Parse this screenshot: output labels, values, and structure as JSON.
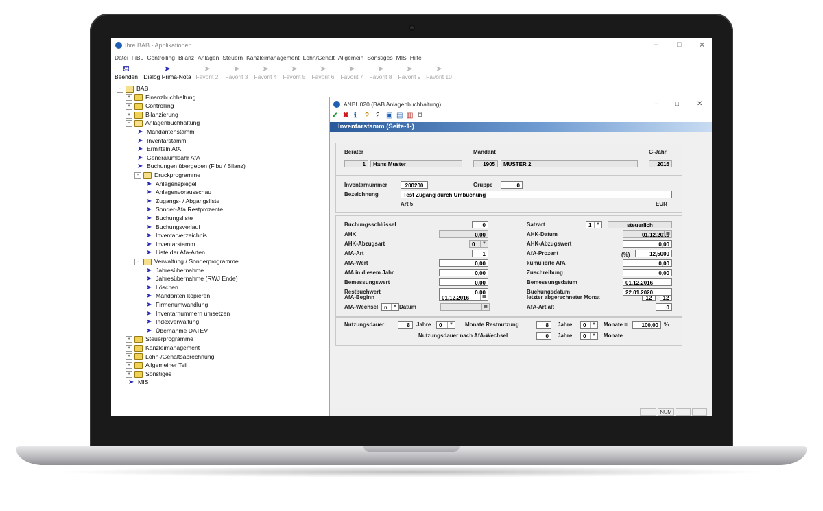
{
  "window": {
    "title": "Ihre BAB - Applikationen",
    "controls": [
      "–",
      "□",
      "✕"
    ]
  },
  "menu": [
    "Datei",
    "FiBu",
    "Controlling",
    "Bilanz",
    "Anlagen",
    "Steuern",
    "Kanzleimanagement",
    "Lohn/Gehalt",
    "Allgemein",
    "Sonstiges",
    "MIS",
    "Hilfe"
  ],
  "toolbar": [
    {
      "label": "Beenden",
      "icon": "exit-icon",
      "enabled": true
    },
    {
      "label": "Dialog Prima-Nota",
      "icon": "arrow-icon",
      "enabled": true
    },
    {
      "label": "Favorit 2",
      "icon": "arrow-icon",
      "enabled": false
    },
    {
      "label": "Favorit 3",
      "icon": "arrow-icon",
      "enabled": false
    },
    {
      "label": "Favorit 4",
      "icon": "arrow-icon",
      "enabled": false
    },
    {
      "label": "Favorit 5",
      "icon": "arrow-icon",
      "enabled": false
    },
    {
      "label": "Favorit 6",
      "icon": "arrow-icon",
      "enabled": false
    },
    {
      "label": "Favorit 7",
      "icon": "arrow-icon",
      "enabled": false
    },
    {
      "label": "Favorit 8",
      "icon": "arrow-icon",
      "enabled": false
    },
    {
      "label": "Favorit 9",
      "icon": "arrow-icon",
      "enabled": false
    },
    {
      "label": "Favorit 10",
      "icon": "arrow-icon",
      "enabled": false
    }
  ],
  "tree": [
    {
      "label": "BAB",
      "level": 0,
      "type": "folder-open",
      "exp": "-"
    },
    {
      "label": "Finanzbuchhaltung",
      "level": 1,
      "type": "folder",
      "exp": "+"
    },
    {
      "label": "Controlling",
      "level": 1,
      "type": "folder",
      "exp": "+"
    },
    {
      "label": "Bilanzierung",
      "level": 1,
      "type": "folder",
      "exp": "+"
    },
    {
      "label": "Anlagenbuchhaltung",
      "level": 1,
      "type": "folder-open",
      "exp": "-"
    },
    {
      "label": "Mandantenstamm",
      "level": 2,
      "type": "arrow"
    },
    {
      "label": "Inventarstamm",
      "level": 2,
      "type": "arrow"
    },
    {
      "label": "Ermitteln AfA",
      "level": 2,
      "type": "arrow"
    },
    {
      "label": "Generalumlsahr AfA",
      "level": 2,
      "type": "arrow"
    },
    {
      "label": "Buchungen übergeben (Fibu / Bilanz)",
      "level": 2,
      "type": "arrow"
    },
    {
      "label": "Druckprogramme",
      "level": 2,
      "type": "folder-open",
      "exp": "-"
    },
    {
      "label": "Anlagenspiegel",
      "level": 3,
      "type": "arrow"
    },
    {
      "label": "Anlagenvorausschau",
      "level": 3,
      "type": "arrow"
    },
    {
      "label": "Zugangs- / Abgangsliste",
      "level": 3,
      "type": "arrow"
    },
    {
      "label": "Sonder-Afa Restprozente",
      "level": 3,
      "type": "arrow"
    },
    {
      "label": "Buchungsliste",
      "level": 3,
      "type": "arrow"
    },
    {
      "label": "Buchungsverlauf",
      "level": 3,
      "type": "arrow"
    },
    {
      "label": "Inventarverzeichnis",
      "level": 3,
      "type": "arrow"
    },
    {
      "label": "Inventarstamm",
      "level": 3,
      "type": "arrow"
    },
    {
      "label": "Liste der Afa-Arten",
      "level": 3,
      "type": "arrow"
    },
    {
      "label": "Verwaltung / Sonderprogramme",
      "level": 2,
      "type": "folder-open",
      "exp": "-"
    },
    {
      "label": "Jahresübernahme",
      "level": 3,
      "type": "arrow"
    },
    {
      "label": "Jahresübernahme (RWJ Ende)",
      "level": 3,
      "type": "arrow"
    },
    {
      "label": "Löschen",
      "level": 3,
      "type": "arrow"
    },
    {
      "label": "Mandanten kopieren",
      "level": 3,
      "type": "arrow"
    },
    {
      "label": "Firmenumwandlung",
      "level": 3,
      "type": "arrow"
    },
    {
      "label": "Inventarnummern umsetzen",
      "level": 3,
      "type": "arrow"
    },
    {
      "label": "Indexverwaltung",
      "level": 3,
      "type": "arrow"
    },
    {
      "label": "Übernahme DATEV",
      "level": 3,
      "type": "arrow"
    },
    {
      "label": "Steuerprogramme",
      "level": 1,
      "type": "folder",
      "exp": "+"
    },
    {
      "label": "Kanzleimanagement",
      "level": 1,
      "type": "folder",
      "exp": "+"
    },
    {
      "label": "Lohn-/Gehaltsabrechnung",
      "level": 1,
      "type": "folder",
      "exp": "+"
    },
    {
      "label": "Allgemeiner Teil",
      "level": 1,
      "type": "folder",
      "exp": "+"
    },
    {
      "label": "Sonstiges",
      "level": 1,
      "type": "folder",
      "exp": "+"
    },
    {
      "label": "MIS",
      "level": 1,
      "type": "arrow"
    }
  ],
  "dialog": {
    "title": "ANBU020 (BAB Anlagenbuchhaltung)",
    "controls": [
      "–",
      "□",
      "✕"
    ],
    "tools": [
      "✔",
      "✖",
      "ℹ",
      "?",
      "2",
      "▣",
      "▤",
      "▥",
      "⚙"
    ],
    "banner": "Inventarstamm (Seite-1-)",
    "berater_label": "Berater",
    "berater_nr": "1",
    "berater_name": "Hans Muster",
    "mandant_label": "Mandant",
    "mandant_nr": "1905",
    "mandant_name": "MUSTER 2",
    "gjahr_label": "G-Jahr",
    "gjahr": "2016",
    "inventarnummer_label": "Inventarnummer",
    "inventarnummer": "200200",
    "gruppe_label": "Gruppe",
    "gruppe": "0",
    "bezeichnung_label": "Bezeichnung",
    "bezeichnung": "Test Zugang durch Umbuchung",
    "art": "Art 5",
    "currency": "EUR",
    "left_fields": [
      {
        "label": "Buchungsschlüssel",
        "value": "0"
      },
      {
        "label": "AHK",
        "value": "0,00"
      },
      {
        "label": "AHK-Abzugsart",
        "value": "0"
      },
      {
        "label": "AfA-Art",
        "value": "1"
      },
      {
        "label": "AfA-Wert",
        "value": "0,00"
      },
      {
        "label": "AfA in diesem Jahr",
        "value": "0,00"
      },
      {
        "label": "Bemessungswert",
        "value": "0,00"
      },
      {
        "label": "Restbuchwert",
        "value": "0,00"
      },
      {
        "label": "AfA-Beginn",
        "value": "01.12.2016"
      },
      {
        "label": "AfA-Wechsel",
        "value": "n"
      }
    ],
    "datum_label": "Datum",
    "satzart_label": "Satzart",
    "satzart_nr": "1",
    "satzart_text": "steuerlich",
    "right_fields": [
      {
        "label": "AHK-Datum",
        "value": "01.12.2016"
      },
      {
        "label": "AHK-Abzugswert",
        "value": "0,00"
      },
      {
        "label": "AfA-Prozent",
        "value": "12,5000"
      },
      {
        "label": "kumulierte AfA",
        "value": "0,00"
      },
      {
        "label": "Zuschreibung",
        "value": "0,00"
      },
      {
        "label": "Bemessungsdatum",
        "value": "01.12.2016"
      },
      {
        "label": "Buchungsdatum",
        "value": "22.01.2020"
      }
    ],
    "percent_sign": "(%)",
    "letzter_monat_label": "letzter abgerechneter Monat",
    "letzter_monat_a": "12",
    "letzter_monat_b": "12",
    "afa_art_alt_label": "AfA-Art alt",
    "afa_art_alt": "0",
    "nutzungsdauer_label": "Nutzungsdauer",
    "nutzungsdauer": "8",
    "jahre_label": "Jahre",
    "nd_jahre_dd": "0",
    "monate_restnutzung_label": "Monate Restnutzung",
    "restnutzung_jahre": "8",
    "restnutzung_monate_dd": "0",
    "monate_label": "Monate =",
    "prozent": "100,00",
    "prozent_sign": "%",
    "nd_wechsel_label": "Nutzungsdauer nach AfA-Wechsel",
    "nd_wechsel_jahre": "0",
    "nd_wechsel_monate_dd": "0",
    "monate2_label": "Monate",
    "status_num": "NUM"
  }
}
